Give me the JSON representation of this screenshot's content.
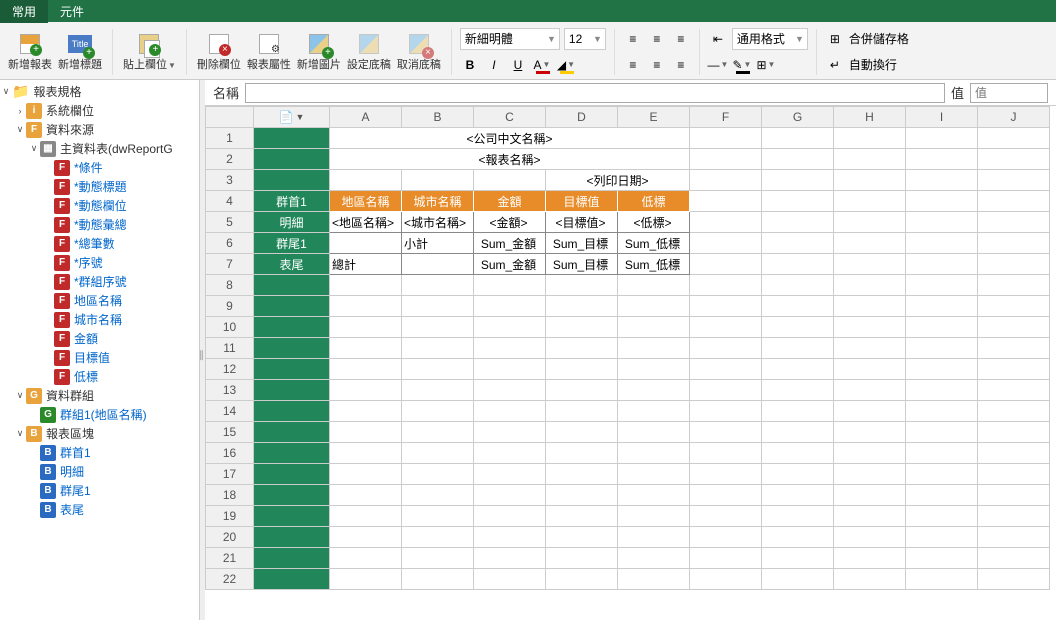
{
  "tabs": {
    "main": "常用",
    "components": "元件"
  },
  "ribbon": {
    "addReport": "新增報表",
    "addTitle": "新增標題",
    "pasteCol": "貼上欄位",
    "delCol": "刪除欄位",
    "reportAttr": "報表屬性",
    "addImg": "新增圖片",
    "setDraft": "設定底稿",
    "cancelDraft": "取消底稿",
    "font": "新細明體",
    "size": "12",
    "format": "通用格式",
    "mergeCells": "合併儲存格",
    "autoWrap": "自動換行"
  },
  "formula": {
    "nameLabel": "名稱",
    "nameValue": "",
    "valueLabel": "值",
    "valuePlaceholder": "值"
  },
  "tree": {
    "root": "報表規格",
    "sysCol": "系統欄位",
    "dataSrc": "資料來源",
    "mainTable": "主資料表(dwReportG",
    "f": [
      "*條件",
      "*動態標題",
      "*動態欄位",
      "*動態彙總",
      "*總筆數",
      "*序號",
      "*群組序號",
      "地區名稱",
      "城市名稱",
      "金額",
      "目標值",
      "低標"
    ],
    "dataGroup": "資料群組",
    "group1": "群組1(地區名稱)",
    "reportBlock": "報表區塊",
    "b": [
      "群首1",
      "明細",
      "群尾1",
      "表尾"
    ]
  },
  "grid": {
    "cols": [
      "A",
      "B",
      "C",
      "D",
      "E",
      "F",
      "G",
      "H",
      "I",
      "J"
    ],
    "rowCount": 22,
    "sections": {
      "1": "",
      "2": "",
      "3": "",
      "4": "群首1",
      "5": "明細",
      "6": "群尾1",
      "7": "表尾"
    },
    "r1": {
      "centered": "<公司中文名稱>"
    },
    "r2": {
      "centered": "<報表名稱>"
    },
    "r3": {
      "printDate": "<列印日期>"
    },
    "hdr": [
      "地區名稱",
      "城市名稱",
      "金額",
      "目標值",
      "低標"
    ],
    "detail": [
      "<地區名稱>",
      "<城市名稱>",
      "<金額>",
      "<目標值>",
      "<低標>"
    ],
    "subtotal": [
      "",
      "小計",
      "Sum_金額",
      "Sum_目標",
      "Sum_低標"
    ],
    "total": [
      "總計",
      "",
      "Sum_金額",
      "Sum_目標",
      "Sum_低標"
    ]
  },
  "colors": {
    "brand": "#217346",
    "section": "#21875a",
    "orange": "#e88c2a"
  }
}
